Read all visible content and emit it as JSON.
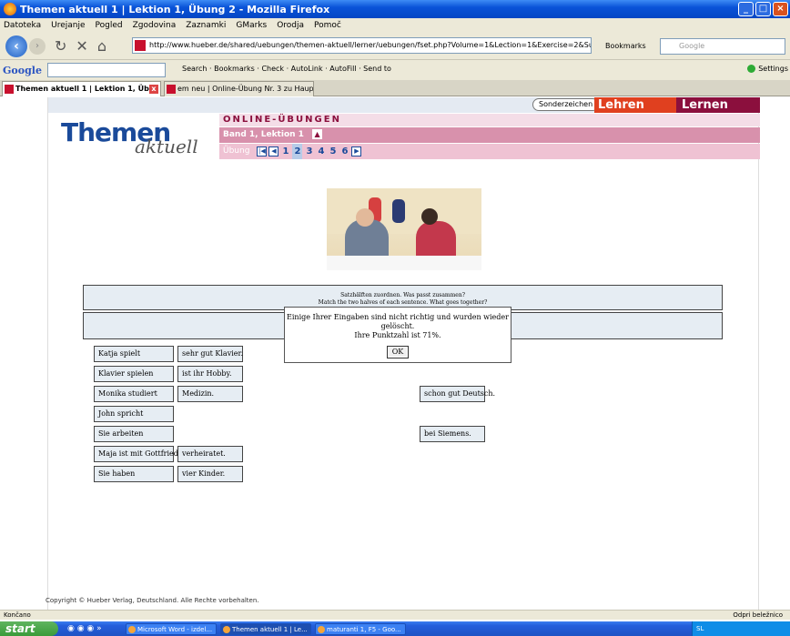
{
  "window": {
    "title": "Themen aktuell 1 | Lektion 1, Übung 2 - Mozilla Firefox",
    "controls": [
      "_",
      "□",
      "×"
    ]
  },
  "menu": [
    "Datoteka",
    "Urejanje",
    "Pogled",
    "Zgodovina",
    "Zaznamki",
    "GMarks",
    "Orodja",
    "Pomoč"
  ],
  "nav": {
    "url": "http://www.hueber.de/shared/uebungen/themen-aktuell/lerner/uebungen/fset.php?Volume=1&Lection=1&Exercise=2&SubExercise=1",
    "bookmarks_label": "Bookmarks",
    "search_placeholder": "Google"
  },
  "google_toolbar": {
    "logo": "Google",
    "items": "Search · Bookmarks · Check · AutoLink · AutoFill · Send to",
    "settings": "Settings"
  },
  "tabs": [
    {
      "label": "Themen aktuell 1 | Lektion 1, Üb..."
    },
    {
      "label": "em neu | Online-Übung Nr. 3 zu Hauptk..."
    }
  ],
  "page": {
    "sonderzeichen": "Sonderzeichen",
    "lehren": "Lehren",
    "lernen": "Lernen",
    "logo_main": "Themen",
    "logo_sub": "aktuell",
    "online_header": "ONLINE-ÜBUNGEN",
    "band": "Band 1, Lektion 1",
    "uebung_label": "Übung",
    "page_numbers": [
      "1",
      "2",
      "3",
      "4",
      "5",
      "6"
    ],
    "current_page": "2",
    "instruction_de": "Satzhälften zuordnen. Was passt zusammen?",
    "instruction_en": "Match the two halves of each sentence. What goes together?",
    "left_items": [
      "Katja spielt",
      "Klavier spielen",
      "Monika studiert",
      "John spricht",
      "Sie arbeiten",
      "Maja ist mit Gottfried",
      "Sie haben"
    ],
    "right_items": [
      "sehr gut Klavier.",
      "ist ihr Hobby.",
      "Medizin.",
      "verheiratet.",
      "vier Kinder."
    ],
    "far_items": [
      "schon gut Deutsch.",
      "bei Siemens."
    ],
    "dialog_line1": "Einige Ihrer Eingaben sind nicht richtig und wurden wieder gelöscht.",
    "dialog_line2": "Ihre Punktzahl ist 71%.",
    "dialog_ok": "OK",
    "copyright": "Copyright © Hueber Verlag, Deutschland. Alle Rechte vorbehalten."
  },
  "status": {
    "text": "Končano",
    "notebook": "Odpri beležnico"
  },
  "taskbar": {
    "start": "start",
    "buttons": [
      "Microsoft Word - izdel...",
      "Themen aktuell 1 | Le...",
      "maturanti 1, F5 - Goo..."
    ],
    "clock": "SL"
  },
  "colors": {
    "accent_red": "#e0401f",
    "accent_maroon": "#8b0f3d",
    "logo_blue": "#1a4a9a"
  }
}
